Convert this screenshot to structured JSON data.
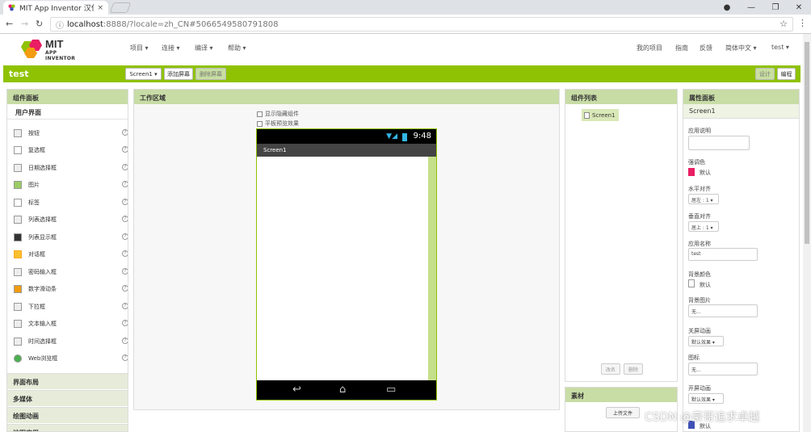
{
  "browser": {
    "tab_title": "MIT App Inventor 汉化版",
    "tab_close": "×",
    "url_host": "localhost",
    "url_path": ":8888/?locale=zh_CN#5066549580791808",
    "window_minimize": "—",
    "window_maximize": "❐",
    "window_close": "✕"
  },
  "topnav": {
    "logo_mit": "MIT",
    "logo_sub": "APP INVENTOR",
    "menus": [
      "项目 ▾",
      "连接 ▾",
      "编译 ▾",
      "帮助 ▾"
    ],
    "links": [
      "我的项目",
      "指南",
      "反馈",
      "简体中文 ▾",
      "test ▾"
    ]
  },
  "toolbar": {
    "project_name": "test",
    "screen_select": "Screen1 ▾",
    "add_screen": "添加屏幕",
    "remove_screen": "删除屏幕",
    "designer": "设计",
    "blocks": "编程"
  },
  "palette": {
    "title": "组件面板",
    "section": "用户界面",
    "items": [
      "按钮",
      "复选框",
      "日期选择框",
      "图片",
      "标签",
      "列表选择框",
      "列表显示框",
      "对话框",
      "密码输入框",
      "数字滑动条",
      "下拉框",
      "文本输入框",
      "时间选择框",
      "Web浏览框"
    ],
    "help": "?",
    "categories": [
      "界面布局",
      "多媒体",
      "绘图动画",
      "地图应用"
    ]
  },
  "viewer": {
    "title": "工作区域",
    "show_hidden": "显示隐藏组件",
    "tablet_preview": "平板预览效果",
    "phone_time": "9:48",
    "screen_title": "Screen1"
  },
  "components": {
    "title": "组件列表",
    "tree_root": "Screen1",
    "rename": "改名",
    "delete": "删除"
  },
  "media": {
    "title": "素材",
    "upload": "上传文件"
  },
  "properties": {
    "title": "属性面板",
    "component": "Screen1",
    "about_label": "应用说明",
    "accent_label": "强调色",
    "accent_value": "默认",
    "halign_label": "水平对齐",
    "halign_value": "居左 : 1 ▾",
    "valign_label": "垂直对齐",
    "valign_value": "居上 : 1 ▾",
    "appname_label": "应用名称",
    "appname_value": "test",
    "bgcolor_label": "背景颜色",
    "bgcolor_value": "默认",
    "bgimage_label": "背景图片",
    "bgimage_value": "无...",
    "close_anim_label": "关屏动画",
    "close_anim_value": "默认效果 ▾",
    "icon_label": "图标",
    "icon_value": "无...",
    "open_anim_label": "开屏动画",
    "open_anim_value": "默认效果 ▾",
    "primary_value": "默认"
  },
  "watermark": "CSDN @豪哥追求卓越",
  "colors": {
    "green": "#8fc202",
    "accent": "#e91e63",
    "primary": "#3f51b5"
  }
}
